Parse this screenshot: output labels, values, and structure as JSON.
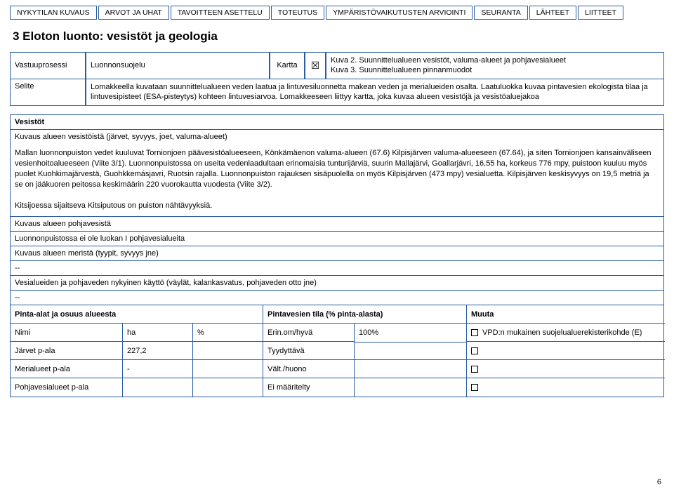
{
  "tabs": [
    "NYKYTILAN KUVAUS",
    "ARVOT JA UHAT",
    "TAVOITTEEN ASETTELU",
    "TOTEUTUS",
    "YMPÄRISTÖVAIKUTUSTEN ARVIOINTI",
    "SEURANTA",
    "LÄHTEET",
    "LIITTEET"
  ],
  "title": "3 Eloton luonto: vesistöt ja geologia",
  "vastuu_label": "Vastuuprosessi",
  "vastuu_value": "Luonnonsuojelu",
  "kartta_label": "Kartta",
  "kartta_checked": "☒",
  "kuva_lines": "Kuva 2. Suunnittelualueen vesistöt, valuma-alueet ja pohjavesialueet\nKuva 3. Suunnittelualueen pinnanmuodot",
  "selite_label": "Selite",
  "selite_body": "Lomakkeella kuvataan suunnittelualueen veden laatua ja lintuvesiluonnetta makean veden ja merialueiden osalta. Laatuluokka kuvaa pintavesien ekologista tilaa ja lintuvesipisteet (ESA-pisteytys) kohteen lintuvesiarvoa. Lomakkeeseen liittyy kartta, joka kuvaa alueen vesistöjä ja vesistöaluejakoa",
  "vesistot_head": "Vesistöt",
  "kuvaus_sub": "Kuvaus alueen vesistöistä (järvet, syvyys, joet, valuma-alueet)",
  "body_para": "Mallan luonnonpuiston vedet kuuluvat Tornionjoen päävesistöalueeseen, Könkämäenon valuma-alueen (67.6) Kilpisjärven valuma-alueeseen (67.64), ja siten Tornionjoen kansainväliseen vesienhoitoalueeseen (Viite 3/1). Luonnonpuistossa on useita vedenlaadultaan erinomaisia tunturijärviä, suurin Mallajärvi, Goallarjávri, 16,55 ha, korkeus 776 mpy, puistoon kuuluu myös puolet Kuohkimajärvestä, Guohkkemásjavri, Ruotsin rajalla. Luonnonpuiston rajauksen sisäpuolella on myös Kilpisjärven (473 mpy) vesialuetta. Kilpisjärven keskisyvyys on 19,5 metriä ja se on jääkuoren peitossa keskimäärin 220 vuorokautta vuodesta (Viite 3/2).",
  "kitsi": "Kitsijoessa sijaitseva Kitsiputous on puiston nähtävyyksiä.",
  "pohja_head": "Kuvaus alueen pohjavesistä",
  "pohja_body": "Luonnonpuistossa ei ole luokan I pohjavesialueita",
  "merista_head": "Kuvaus alueen meristä (tyypit, syvyys jne)",
  "dash1": "--",
  "vesialue_head": "Vesialueiden ja pohjaveden nykyinen käyttö (väylät, kalankasvatus, pohjaveden otto jne)",
  "dash2": "--",
  "pinta_head": "Pinta-alat ja osuus alueesta",
  "pintavesien_head": "Pintavesien tila (% pinta-alasta)",
  "muuta_head": "Muuta",
  "col_nimi": "Nimi",
  "col_ha": "ha",
  "col_pct": "%",
  "col_erin": "Erin.om/hyvä",
  "pct100": "100%",
  "vpd": "VPD:n mukainen suojelualuerekisterikohde (E)",
  "row1_name": "Järvet p-ala",
  "row1_ha": "227,2",
  "col_tyydy": "Tyydyttävä",
  "row2_name": "Merialueet p-ala",
  "row2_ha": "-",
  "col_valt": "Vält./huono",
  "row3_name": "Pohjavesialueet p-ala",
  "col_eimaar": "Ei määritelty",
  "page_num": "6"
}
